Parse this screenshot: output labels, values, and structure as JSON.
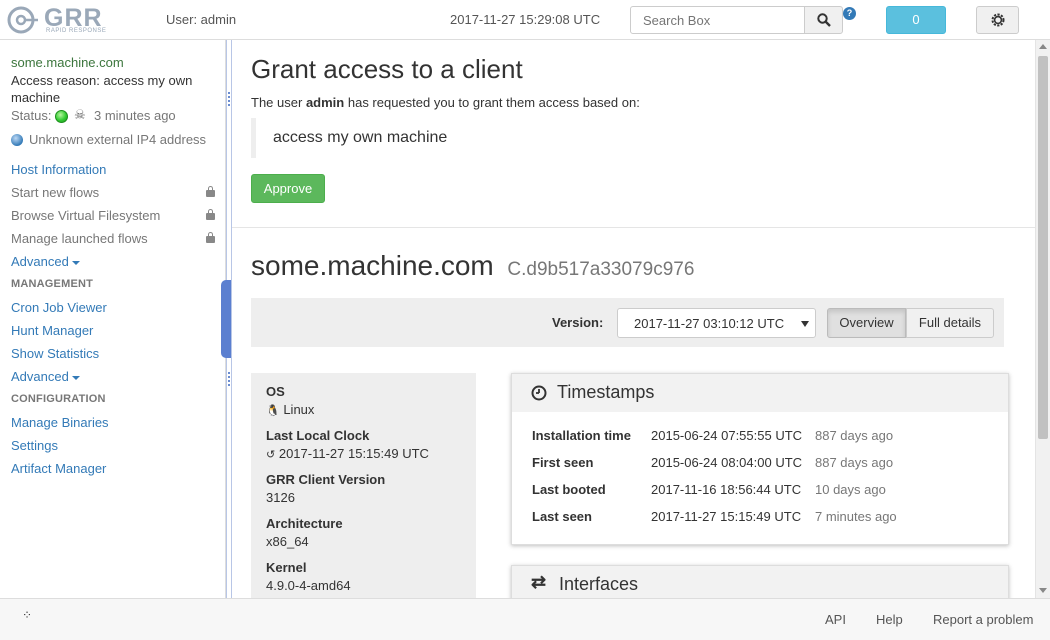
{
  "header": {
    "logo_text": "GRR",
    "logo_sub": "RAPID RESPONSE",
    "user_label": "User: admin",
    "server_time": "2017-11-27 15:29:08 UTC",
    "search_placeholder": "Search Box",
    "notifications_count": "0",
    "help_badge": "?"
  },
  "sidebar": {
    "client_name": "some.machine.com",
    "access_reason": "Access reason: access my own machine",
    "status_label": "Status:",
    "status_time": "3 minutes ago",
    "ip_info": "Unknown external IP4 address",
    "host_information": "Host Information",
    "start_new_flows": "Start new flows",
    "browse_vfs": "Browse Virtual Filesystem",
    "manage_flows": "Manage launched flows",
    "advanced_1": "Advanced",
    "management_header": "MANAGEMENT",
    "cron_job_viewer": "Cron Job Viewer",
    "hunt_manager": "Hunt Manager",
    "show_statistics": "Show Statistics",
    "advanced_2": "Advanced",
    "configuration_header": "CONFIGURATION",
    "manage_binaries": "Manage Binaries",
    "settings": "Settings",
    "artifact_manager": "Artifact Manager"
  },
  "grant": {
    "title": "Grant access to a client",
    "request_pre": "The user",
    "request_user": "admin",
    "request_post": "has requested you to grant them access based on:",
    "reason": "access my own machine",
    "approve": "Approve"
  },
  "client": {
    "hostname": "some.machine.com",
    "client_id": "C.d9b517a33079c976",
    "version_label": "Version:",
    "version_value": "2017-11-27 03:10:12 UTC",
    "tab_overview": "Overview",
    "tab_full_details": "Full details"
  },
  "summary": {
    "os_label": "OS",
    "os_value": "Linux",
    "clock_label": "Last Local Clock",
    "clock_value": "2017-11-27 15:15:49 UTC",
    "grr_version_label": "GRR Client Version",
    "grr_version_value": "3126",
    "arch_label": "Architecture",
    "arch_value": "x86_64",
    "kernel_label": "Kernel",
    "kernel_value": "4.9.0-4-amd64"
  },
  "timestamps": {
    "title": "Timestamps",
    "rows": [
      {
        "label": "Installation time",
        "date": "2015-06-24 07:55:55 UTC",
        "ago": "887 days ago"
      },
      {
        "label": "First seen",
        "date": "2015-06-24 08:04:00 UTC",
        "ago": "887 days ago"
      },
      {
        "label": "Last booted",
        "date": "2017-11-16 18:56:44 UTC",
        "ago": "10 days ago"
      },
      {
        "label": "Last seen",
        "date": "2017-11-27 15:15:49 UTC",
        "ago": "7 minutes ago"
      }
    ]
  },
  "interfaces": {
    "title": "Interfaces"
  },
  "footer": {
    "api": "API",
    "help": "Help",
    "report": "Report a problem"
  },
  "colors": {
    "link": "#337ab7",
    "approve_green": "#5cb85c",
    "notif_blue": "#5bc0de",
    "status_green": "#33cc33"
  }
}
